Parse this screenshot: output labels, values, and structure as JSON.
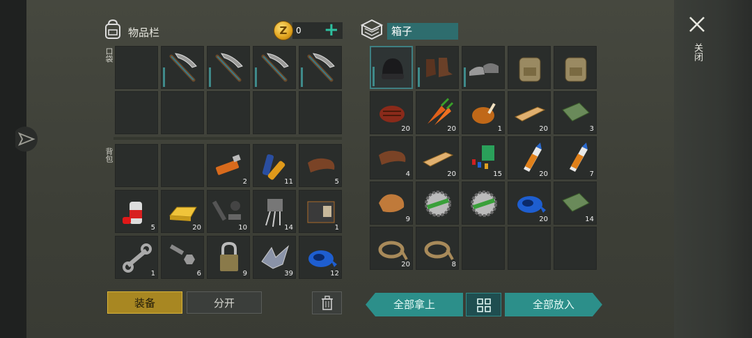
{
  "inventory": {
    "title": "物品栏",
    "coins": "0",
    "pocket_label": "口袋",
    "backpack_label": "背包",
    "pocket": [
      {
        "icon": "",
        "count": ""
      },
      {
        "icon": "pickaxe",
        "count": ""
      },
      {
        "icon": "pickaxe",
        "count": ""
      },
      {
        "icon": "pickaxe",
        "count": ""
      },
      {
        "icon": "pickaxe",
        "count": ""
      },
      {
        "icon": "",
        "count": ""
      },
      {
        "icon": "",
        "count": ""
      },
      {
        "icon": "",
        "count": ""
      },
      {
        "icon": "",
        "count": ""
      },
      {
        "icon": "",
        "count": ""
      }
    ],
    "backpack": [
      {
        "icon": "",
        "count": ""
      },
      {
        "icon": "",
        "count": ""
      },
      {
        "icon": "usb-stick",
        "count": "2"
      },
      {
        "icon": "batteries",
        "count": "11"
      },
      {
        "icon": "leather",
        "count": "5"
      },
      {
        "icon": "spray-can",
        "count": "5"
      },
      {
        "icon": "gold-bar",
        "count": "20"
      },
      {
        "icon": "gun-parts",
        "count": "10"
      },
      {
        "icon": "transistor",
        "count": "14"
      },
      {
        "icon": "wallet",
        "count": "1"
      },
      {
        "icon": "wrench",
        "count": "1"
      },
      {
        "icon": "bolts",
        "count": "6"
      },
      {
        "icon": "padlock",
        "count": "9"
      },
      {
        "icon": "scrap-metal",
        "count": "39"
      },
      {
        "icon": "tape",
        "count": "12"
      }
    ],
    "equip_label": "装备",
    "split_label": "分开"
  },
  "box": {
    "title": "箱子",
    "items": [
      {
        "icon": "beanie",
        "count": ""
      },
      {
        "icon": "boots",
        "count": ""
      },
      {
        "icon": "sneakers",
        "count": ""
      },
      {
        "icon": "backpack",
        "count": ""
      },
      {
        "icon": "backpack",
        "count": ""
      },
      {
        "icon": "steak",
        "count": "20"
      },
      {
        "icon": "carrot",
        "count": "20"
      },
      {
        "icon": "roast-chicken",
        "count": "1"
      },
      {
        "icon": "plank",
        "count": "20"
      },
      {
        "icon": "cloth",
        "count": "3"
      },
      {
        "icon": "leather",
        "count": "4"
      },
      {
        "icon": "plank",
        "count": "20"
      },
      {
        "icon": "components",
        "count": "15"
      },
      {
        "icon": "glue",
        "count": "20"
      },
      {
        "icon": "glue",
        "count": "7"
      },
      {
        "icon": "fur",
        "count": "9"
      },
      {
        "icon": "saw-blade",
        "count": ""
      },
      {
        "icon": "saw-blade",
        "count": ""
      },
      {
        "icon": "tape",
        "count": "20"
      },
      {
        "icon": "cloth",
        "count": "14"
      },
      {
        "icon": "rope",
        "count": "20"
      },
      {
        "icon": "rope",
        "count": "8"
      },
      {
        "icon": "",
        "count": ""
      },
      {
        "icon": "",
        "count": ""
      },
      {
        "icon": "",
        "count": ""
      }
    ],
    "take_all_label": "全部拿上",
    "put_all_label": "全部放入"
  },
  "close_label": "关闭",
  "colors": {
    "accent": "#2c8f8a",
    "equip": "#a88722",
    "coin": "#e0a21c"
  }
}
